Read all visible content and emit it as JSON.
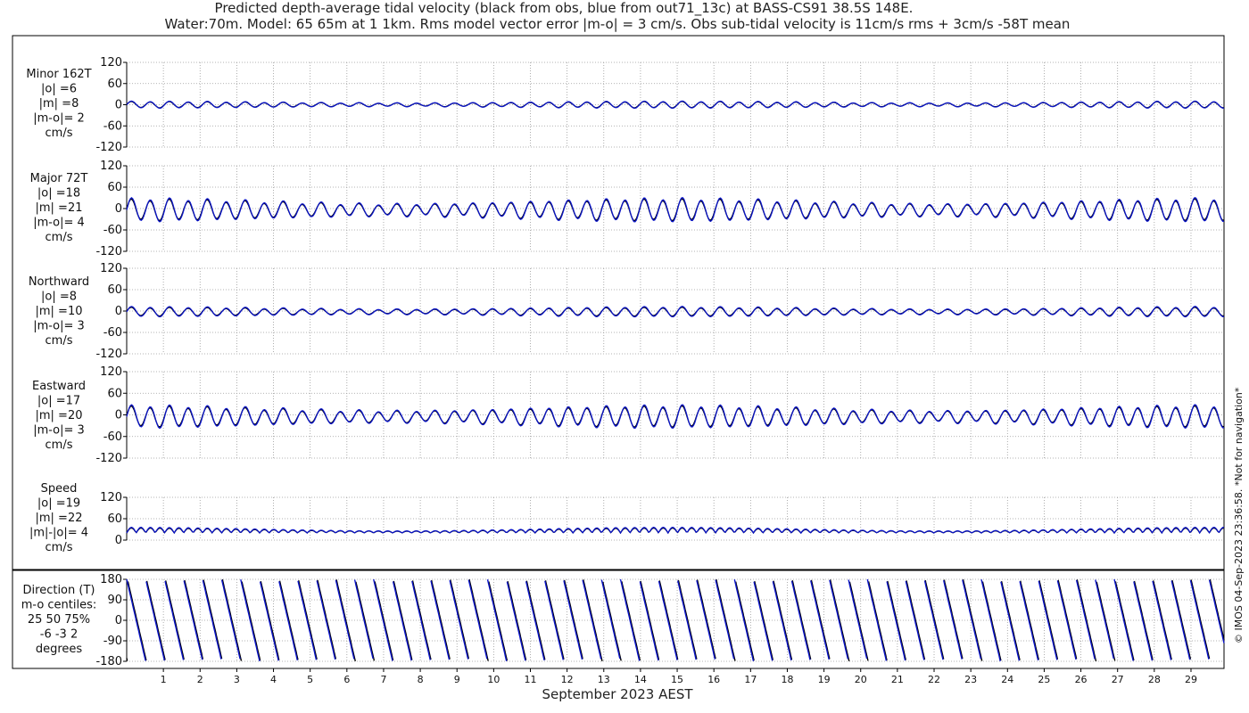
{
  "title_line1": "Predicted depth-average tidal velocity (black from obs, blue from out71_13c) at BASS-CS91 38.5S 148E.",
  "title_line2": "Water:70m. Model: 65 65m at 1 1km. Rms model vector error |m-o| = 3 cm/s. Obs sub-tidal velocity is 11cm/s rms + 3cm/s -58T mean",
  "xlabel": "September 2023 AEST",
  "side_note": "© IMOS 04-Sep-2023 23:36:58. *Not for navigation*",
  "colors": {
    "obs": "#000000",
    "model": "#0a14c8",
    "grid": "#9a9a9a",
    "frame": "#000000"
  },
  "chart_data": [
    {
      "type": "line",
      "name": "minor",
      "label_lines": [
        "Minor 162T",
        "|o| =6",
        "|m| =8",
        "|m-o|= 2",
        "cm/s"
      ],
      "ylim": [
        -120,
        120
      ],
      "yticks": [
        120,
        60,
        0,
        -60,
        -120
      ],
      "amplitude_obs": 8,
      "amplitude_model": 9,
      "offset": 0,
      "series": [
        {
          "name": "obs"
        },
        {
          "name": "model"
        }
      ]
    },
    {
      "type": "line",
      "name": "major",
      "label_lines": [
        "Major 72T",
        "|o| =18",
        "|m| =21",
        "|m-o|= 4",
        "cm/s"
      ],
      "ylim": [
        -120,
        120
      ],
      "yticks": [
        120,
        60,
        0,
        -60,
        -120
      ],
      "amplitude_obs": 27,
      "amplitude_model": 30,
      "offset": -4,
      "series": [
        {
          "name": "obs"
        },
        {
          "name": "model"
        }
      ]
    },
    {
      "type": "line",
      "name": "northward",
      "label_lines": [
        "Northward",
        "|o| =8",
        "|m| =10",
        "|m-o|= 3",
        "cm/s"
      ],
      "ylim": [
        -120,
        120
      ],
      "yticks": [
        120,
        60,
        0,
        -60,
        -120
      ],
      "amplitude_obs": 11,
      "amplitude_model": 13,
      "offset": -2,
      "series": [
        {
          "name": "obs"
        },
        {
          "name": "model"
        }
      ]
    },
    {
      "type": "line",
      "name": "eastward",
      "label_lines": [
        "Eastward",
        "|o| =17",
        "|m| =20",
        "|m-o|= 3",
        "cm/s"
      ],
      "ylim": [
        -120,
        120
      ],
      "yticks": [
        120,
        60,
        0,
        -60,
        -120
      ],
      "amplitude_obs": 26,
      "amplitude_model": 29,
      "offset": -5,
      "series": [
        {
          "name": "obs"
        },
        {
          "name": "model"
        }
      ]
    },
    {
      "type": "line",
      "name": "speed",
      "label_lines": [
        "Speed",
        "|o| =19",
        "|m| =22",
        "|m|-|o|= 4",
        "cm/s"
      ],
      "ylim": [
        0,
        120
      ],
      "yticks": [
        120,
        60,
        0
      ],
      "amplitude_obs": 14,
      "amplitude_model": 16,
      "offset": 18,
      "series": [
        {
          "name": "obs"
        },
        {
          "name": "model"
        }
      ]
    },
    {
      "type": "line",
      "name": "direction",
      "label_lines": [
        "Direction (T)",
        "m-o centiles:",
        "25  50  75%",
        "-6 -3  2",
        "degrees"
      ],
      "ylim": [
        -180,
        180
      ],
      "yticks": [
        180,
        90,
        0,
        -90,
        -180
      ],
      "series": [
        {
          "name": "obs"
        },
        {
          "name": "model"
        }
      ]
    }
  ],
  "x_days": [
    "1",
    "2",
    "3",
    "4",
    "5",
    "6",
    "7",
    "8",
    "9",
    "10",
    "11",
    "12",
    "13",
    "14",
    "15",
    "16",
    "17",
    "18",
    "19",
    "20",
    "21",
    "22",
    "23",
    "24",
    "25",
    "26",
    "27",
    "28",
    "29"
  ],
  "x_start_day": 0.0,
  "x_end_day": 29.9,
  "tidal_period_hours": 12.42
}
